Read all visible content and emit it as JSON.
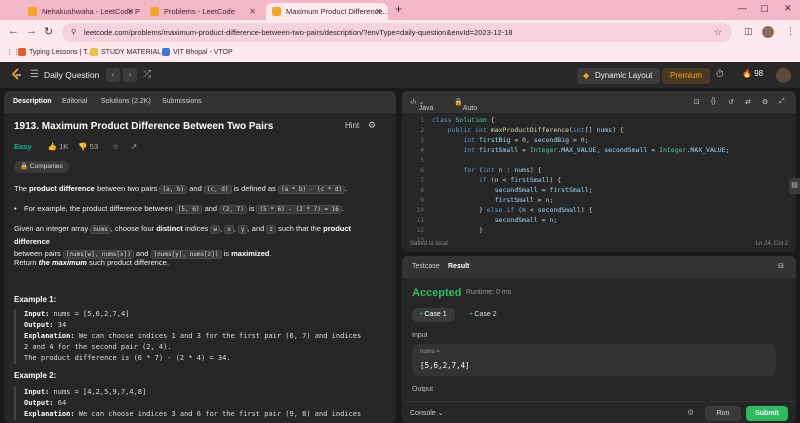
{
  "browser": {
    "tabs": [
      {
        "title": "Nehakushwaha - LeetCode Pro"
      },
      {
        "title": "Problems - LeetCode"
      },
      {
        "title": "Maximum Product Difference..."
      }
    ],
    "url": "leetcode.com/problems/maximum-product-difference-between-two-pairs/description/?envType=daily-question&envId=2023-12-18",
    "bookmarks": [
      "Typing Lessons | T...",
      "STUDY MATERIAL",
      "VIT Bhopal - VTOP"
    ]
  },
  "nav": {
    "title": "Daily Question",
    "dynamic_layout": "Dynamic Layout",
    "premium": "Premium",
    "streak": "98"
  },
  "left": {
    "tabs": [
      "Description",
      "Editorial",
      "Solutions (2.2K)",
      "Submissions"
    ],
    "title": "1913. Maximum Product Difference Between Two Pairs",
    "hint": "Hint",
    "difficulty": "Easy",
    "likes": "1K",
    "dislikes": "53",
    "companies": "Companies",
    "p1_pre": "The ",
    "p1_bold": "product difference",
    "p1_mid1": " between two pairs ",
    "p1_c1": "(a, b)",
    "p1_and": " and ",
    "p1_c2": "(c, d)",
    "p1_mid2": " is defined as ",
    "p1_c3": "(a * b) - (c * d)",
    "p1_end": ".",
    "p2_pre": "For example, the product difference between ",
    "p2_c1": "(5, 6)",
    "p2_and": " and ",
    "p2_c2": "(2, 7)",
    "p2_is": " is ",
    "p2_c3": "(5 * 6) - (2 * 7) = 16",
    "p2_end": ".",
    "p3_a": "Given an integer array ",
    "p3_c1": "nums",
    "p3_b": ", choose four ",
    "p3_bold1": "distinct",
    "p3_c": " indices ",
    "p3_w": "w",
    "p3_x": "x",
    "p3_y": "y",
    "p3_z": "z",
    "p3_d": " such that the ",
    "p3_bold2": "product difference",
    "p3_e": "between pairs ",
    "p3_c2": "(nums[w], nums[x])",
    "p3_f": " and ",
    "p3_c3": "(nums[y], nums[z])",
    "p3_g": " is ",
    "p3_bold3": "maximized",
    "p3_h": ".",
    "p4_a": "Return ",
    "p4_bi": "the maximum",
    "p4_b": " such product difference.",
    "ex1_title": "Example 1:",
    "ex1_input_label": "Input:",
    "ex1_input": " nums = [5,6,2,7,4]",
    "ex1_output_label": "Output:",
    "ex1_output": " 34",
    "ex1_expl_label": "Explanation:",
    "ex1_expl_1": " We can choose indices 1 and 3 for the first pair (6, 7) and indices",
    "ex1_expl_2": "2 and 4 for the second pair (2, 4).",
    "ex1_expl_3": "The product difference is (6 * 7) - (2 * 4) = 34.",
    "ex2_title": "Example 2:",
    "ex2_input_label": "Input:",
    "ex2_input": " nums = [4,2,5,9,7,4,8]",
    "ex2_output_label": "Output:",
    "ex2_output": " 64",
    "ex2_expl_label": "Explanation:",
    "ex2_expl_1": " We can choose indices 3 and 6 for the first pair (9, 8) and indices"
  },
  "editor": {
    "language": "Java",
    "mode": "Auto",
    "status": "Saved to local",
    "cursor": "Ln 24, Col 2"
  },
  "testcase": {
    "tabs": [
      "Testcase",
      "Result"
    ],
    "verdict": "Accepted",
    "runtime": "Runtime: 0 ms",
    "cases": [
      "Case 1",
      "Case 2"
    ],
    "input_label": "Input",
    "var_name": "nums =",
    "var_value": "[5,6,2,7,4]",
    "output_label": "Output",
    "console": "Console",
    "run": "Run",
    "submit": "Submit"
  },
  "colors": {
    "accent": "#ffa116",
    "success": "#2cbb5d",
    "easy": "#00b8a3"
  }
}
